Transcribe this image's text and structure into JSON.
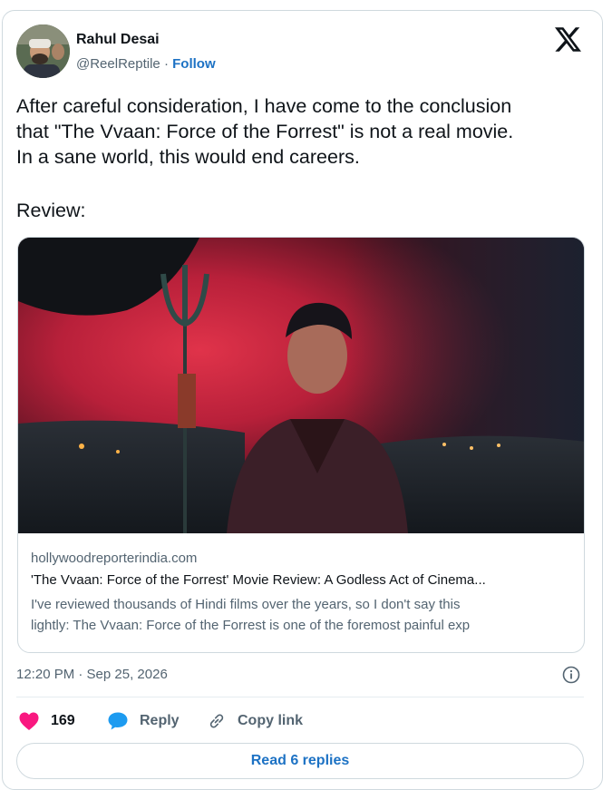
{
  "author": {
    "name": "Rahul Desai",
    "handle": "@ReelReptile",
    "separator": " · ",
    "follow_label": "Follow"
  },
  "icons": {
    "logo": "x-logo-icon",
    "info": "info-icon",
    "like": "heart-icon",
    "reply": "speech-bubble-icon",
    "copy": "link-icon"
  },
  "colors": {
    "accent": "#1d72c4",
    "like": "#f91880",
    "reply": "#1d9bf0",
    "muted": "#536471"
  },
  "tweet": {
    "text_lines": [
      "After careful consideration, I have come to the conclusion",
      "that \"The Vvaan: Force of the Forrest\" is not a real movie.",
      "In a sane world, this would end careers."
    ],
    "review_label": "Review:",
    "timestamp": "12:20 PM · Sep 25, 2026"
  },
  "link_card": {
    "domain": "hollywoodreporterindia.com",
    "title": "'The Vvaan: Force of the Forrest' Movie Review: A Godless Act of Cinema...",
    "description_lines": [
      "I've reviewed thousands of Hindi films over the years, so I don't say this",
      "lightly: The Vvaan: Force of the Forrest is one of the foremost painful exp"
    ]
  },
  "actions": {
    "likes_count": "169",
    "reply_label": "Reply",
    "copy_label": "Copy link"
  },
  "read_replies_label": "Read 6 replies"
}
